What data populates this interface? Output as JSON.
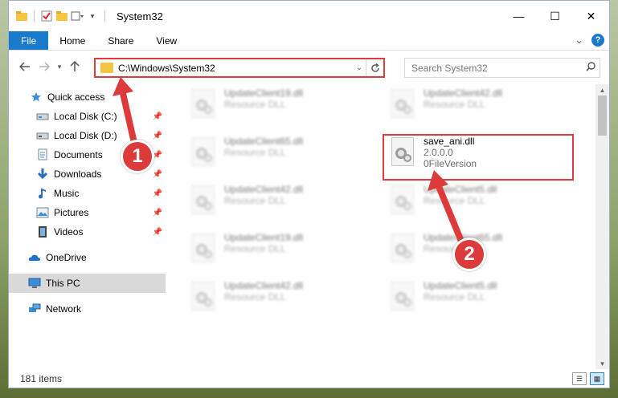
{
  "window": {
    "title": "System32"
  },
  "controls": {
    "minimize": "—",
    "maximize": "☐",
    "close": "✕"
  },
  "ribbon": {
    "tabs": [
      {
        "label": "File"
      },
      {
        "label": "Home"
      },
      {
        "label": "Share"
      },
      {
        "label": "View"
      }
    ],
    "expand": "⌄",
    "help": "?"
  },
  "address": {
    "path": "C:\\Windows\\System32",
    "search_placeholder": "Search System32"
  },
  "nav": {
    "items": [
      {
        "label": "Quick access",
        "icon": "star-icon"
      },
      {
        "label": "Local Disk (C:)",
        "icon": "drive-icon",
        "pinned": true
      },
      {
        "label": "Local Disk (D:)",
        "icon": "drive-icon",
        "pinned": true
      },
      {
        "label": "Documents",
        "icon": "documents-icon",
        "pinned": true
      },
      {
        "label": "Downloads",
        "icon": "downloads-icon",
        "pinned": true
      },
      {
        "label": "Music",
        "icon": "music-icon",
        "pinned": true
      },
      {
        "label": "Pictures",
        "icon": "pictures-icon",
        "pinned": true
      },
      {
        "label": "Videos",
        "icon": "videos-icon",
        "pinned": true
      },
      {
        "label": "OneDrive",
        "icon": "onedrive-icon"
      },
      {
        "label": "This PC",
        "icon": "pc-icon",
        "selected": true
      },
      {
        "label": "Network",
        "icon": "network-icon"
      }
    ]
  },
  "files": [
    {
      "name": "UpdateClient19.dll",
      "type": "Resource DLL"
    },
    {
      "name": "UpdateClient42.dll",
      "type": "Resource DLL"
    },
    {
      "name": "UpdateClient65.dll",
      "type": "Resource DLL"
    },
    {
      "name": "save_ani.dll",
      "version": "2.0.0.0",
      "desc": "0FileVersion"
    },
    {
      "name": "UpdateClient42.dll",
      "type": "Resource DLL"
    },
    {
      "name": "UpdateClient5.dll",
      "type": "Resource DLL"
    },
    {
      "name": "UpdateClient19.dll",
      "type": "Resource DLL"
    },
    {
      "name": "UpdateClient65.dll",
      "type": "Resource DLL"
    },
    {
      "name": "UpdateClient42.dll",
      "type": "Resource DLL"
    },
    {
      "name": "UpdateClient5.dll",
      "type": "Resource DLL"
    }
  ],
  "status": {
    "items": "181 items"
  },
  "annotations": {
    "step1": "1",
    "step2": "2"
  },
  "colors": {
    "accent": "#1979ca",
    "highlight": "#e0393e",
    "badge": "#dd3b3b"
  }
}
